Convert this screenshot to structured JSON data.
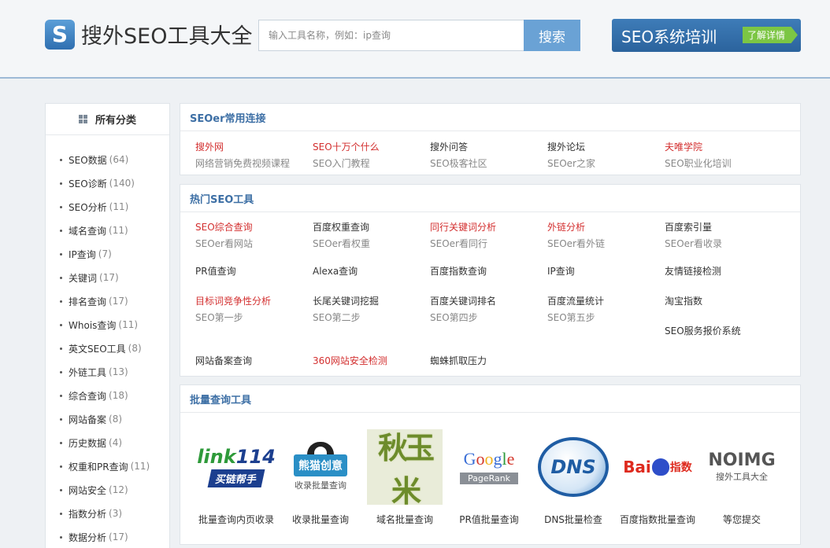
{
  "header": {
    "logo_mark": "S",
    "logo_text": "搜外SEO工具大全",
    "search_placeholder": "输入工具名称，例如：ip查询",
    "search_button": "搜索",
    "promo_title": "SEO系统培训",
    "promo_tag": "了解详情"
  },
  "sidebar": {
    "title": "所有分类",
    "items": [
      {
        "label": "SEO数据",
        "count": "(64)"
      },
      {
        "label": "SEO诊断",
        "count": "(140)"
      },
      {
        "label": "SEO分析",
        "count": "(11)"
      },
      {
        "label": "域名查询",
        "count": "(11)"
      },
      {
        "label": "IP查询",
        "count": "(7)"
      },
      {
        "label": "关键词",
        "count": "(17)"
      },
      {
        "label": "排名查询",
        "count": "(17)"
      },
      {
        "label": "Whois查询",
        "count": "(11)"
      },
      {
        "label": "英文SEO工具",
        "count": "(8)"
      },
      {
        "label": "外链工具",
        "count": "(13)"
      },
      {
        "label": "综合查询",
        "count": "(18)"
      },
      {
        "label": "网站备案",
        "count": "(8)"
      },
      {
        "label": "历史数据",
        "count": "(4)"
      },
      {
        "label": "权重和PR查询",
        "count": "(11)"
      },
      {
        "label": "网站安全",
        "count": "(12)"
      },
      {
        "label": "指数分析",
        "count": "(3)"
      },
      {
        "label": "数据分析",
        "count": "(17)"
      }
    ]
  },
  "common_links": {
    "title": "SEOer常用连接",
    "items": [
      {
        "title": "搜外网",
        "sub": "网络营销免费视频课程",
        "red": true
      },
      {
        "title": "SEO十万个什么",
        "sub": "SEO入门教程",
        "red": true
      },
      {
        "title": "搜外问答",
        "sub": "SEO极客社区",
        "red": false
      },
      {
        "title": "搜外论坛",
        "sub": "SEOer之家",
        "red": false
      },
      {
        "title": "夫唯学院",
        "sub": "SEO职业化培训",
        "red": true
      }
    ]
  },
  "hot_tools": {
    "title": "热门SEO工具",
    "items": [
      {
        "title": "SEO综合查询",
        "sub": "SEOer看网站",
        "red": true
      },
      {
        "title": "百度权重查询",
        "sub": "SEOer看权重",
        "red": false
      },
      {
        "title": "同行关键词分析",
        "sub": "SEOer看同行",
        "red": true
      },
      {
        "title": "外链分析",
        "sub": "SEOer看外链",
        "red": true
      },
      {
        "title": "百度索引量",
        "sub": "SEOer看收录",
        "red": false
      },
      {
        "title": "PR值查询",
        "sub": "",
        "red": false
      },
      {
        "title": "Alexa查询",
        "sub": "",
        "red": false
      },
      {
        "title": "百度指数查询",
        "sub": "",
        "red": false
      },
      {
        "title": "IP查询",
        "sub": "",
        "red": false
      },
      {
        "title": "友情链接检测",
        "sub": "",
        "red": false
      },
      {
        "title": "目标词竞争性分析",
        "sub": "SEO第一步",
        "red": true
      },
      {
        "title": "长尾关键词挖掘",
        "sub": "SEO第二步",
        "red": false
      },
      {
        "title": "百度关键词排名",
        "sub": "SEO第四步",
        "red": false
      },
      {
        "title": "百度流量统计",
        "sub": "SEO第五步",
        "red": false
      },
      {
        "title": "淘宝指数",
        "sub": "",
        "red": false
      },
      {
        "title": "SEO服务报价系统",
        "sub": "",
        "red": false
      },
      {
        "title": "网站备案查询",
        "sub": "",
        "red": false
      },
      {
        "title": "360网站安全检测",
        "sub": "",
        "red": true
      },
      {
        "title": "蜘蛛抓取压力",
        "sub": "",
        "red": false
      }
    ]
  },
  "batch_tools": {
    "title": "批量查询工具",
    "items": [
      {
        "label": "批量查询内页收录",
        "logo": "link114",
        "logo_sub": "买链帮手"
      },
      {
        "label": "收录批量查询",
        "logo": "熊猫创意",
        "logo_sub": "收录批量查询"
      },
      {
        "label": "域名批量查询",
        "logo": "秋玉米",
        "logo_sub": ""
      },
      {
        "label": "PR值批量查询",
        "logo": "Google",
        "logo_sub": "PageRank"
      },
      {
        "label": "DNS批量检查",
        "logo": "DNS",
        "logo_sub": ""
      },
      {
        "label": "百度指数批量查询",
        "logo": "Bai",
        "logo_sub": "指数"
      },
      {
        "label": "等您提交",
        "logo": "NOIMG",
        "logo_sub": "搜外工具大全"
      }
    ]
  }
}
